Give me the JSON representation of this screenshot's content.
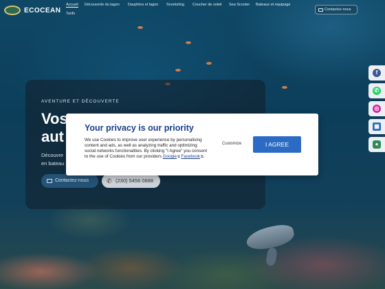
{
  "brand": {
    "name": "ECOCEAN"
  },
  "nav": {
    "items": [
      {
        "label": "Accueil",
        "active": true
      },
      {
        "label": "Découverte du lagon",
        "active": false
      },
      {
        "label": "Dauphins et lagon",
        "active": false
      },
      {
        "label": "Snorkeling",
        "active": false
      },
      {
        "label": "Coucher de soleil",
        "active": false
      },
      {
        "label": "Sea Scooter",
        "active": false
      },
      {
        "label": "Bateaux et equipage",
        "active": false
      },
      {
        "label": "Tarifs",
        "active": false
      }
    ],
    "contact_label": "Contactez-nous"
  },
  "hero": {
    "eyebrow": "Aventure et découverte",
    "title_line1": "Vos",
    "title_line2": "aut",
    "desc_line1": "Découvre",
    "desc_line2": "en bateau",
    "contact_button": "Contactez-nous",
    "phone_button": "(230) 5456 0888"
  },
  "social": [
    {
      "icon": "facebook-icon",
      "color": "#3b5998",
      "glyph": "f"
    },
    {
      "icon": "whatsapp-icon",
      "color": "#25d366",
      "glyph": "✆"
    },
    {
      "icon": "instagram-icon",
      "color": "#d6249f",
      "glyph": "◎"
    },
    {
      "icon": "calendar-icon",
      "color": "#2c6bc4",
      "glyph": "▦"
    },
    {
      "icon": "chat-icon",
      "color": "#2e8b57",
      "glyph": "●"
    }
  ],
  "privacy": {
    "title": "Your privacy is our priority",
    "text_before": "We use Cookies to improve user experience by personalising content and ads, as well as analyzing traffic and optimizing social networks functionalities. By clicking \"I Agree\" you consent to the use of Cookies from our providers ",
    "link_google": "Google",
    "link_facebook": "Facebook",
    "text_after": ".",
    "customize_label": "Customize",
    "agree_label": "I AGREE"
  }
}
